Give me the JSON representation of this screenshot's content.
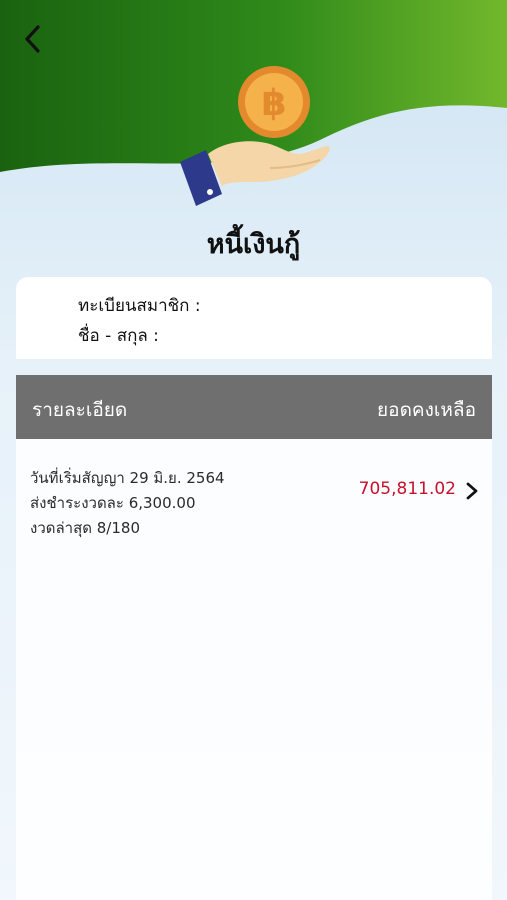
{
  "header": {
    "back_icon": "chevron-left-icon",
    "hero_icon": "hand-with-baht-coin-icon",
    "coin_symbol": "฿",
    "title": "หนี้เงินกู้",
    "colors": {
      "dark_green": "#1f6b12",
      "light_green": "#6db52a",
      "coin": "#f0a43a"
    }
  },
  "member": {
    "id_label": "ทะเบียนสมาชิก :",
    "name_label": "ชื่อ - สกุล :"
  },
  "table": {
    "col_detail": "รายละเอียด",
    "col_balance": "ยอดคงเหลือ",
    "header_color": "#6f6f6f",
    "rows": [
      {
        "start_date": "วันที่เริ่มสัญญา 29 มิ.ย. 2564",
        "installment": "ส่งชำระงวดละ 6,300.00",
        "latest": "งวดล่าสุด 8/180",
        "balance": "705,811.02",
        "balance_color": "#c8102e",
        "action_icon": "chevron-right-icon"
      }
    ]
  }
}
